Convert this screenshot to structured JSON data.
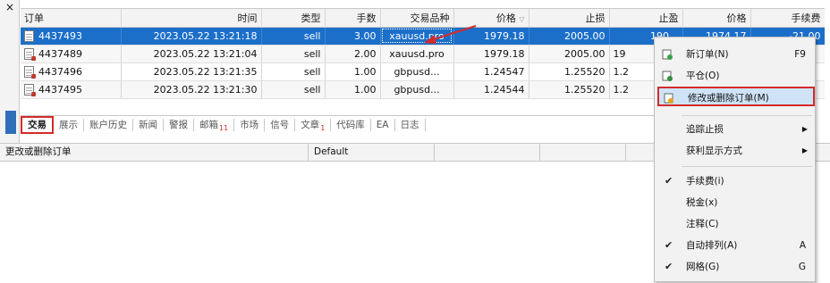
{
  "window": {
    "close_glyph": "×"
  },
  "table": {
    "headers": [
      "订单",
      "时间",
      "类型",
      "手数",
      "交易品种",
      "价格",
      "止损",
      "止盈",
      "价格",
      "手续费"
    ],
    "rows": [
      {
        "order": "4437493",
        "time": "2023.05.22 13:21:18",
        "type": "sell",
        "lots": "3.00",
        "symbol": "xauusd.pro",
        "price": "1979.18",
        "sl": "2005.00",
        "tp": "190...",
        "cur_price": "1974.17",
        "fee": "-21.00"
      },
      {
        "order": "4437489",
        "time": "2023.05.22 13:21:04",
        "type": "sell",
        "lots": "2.00",
        "symbol": "xauusd.pro",
        "price": "1979.18",
        "sl": "2005.00",
        "tp": "19",
        "cur_price": "",
        "fee": ""
      },
      {
        "order": "4437496",
        "time": "2023.05.22 13:21:35",
        "type": "sell",
        "lots": "1.00",
        "symbol": "gbpusd...",
        "price": "1.24547",
        "sl": "1.25520",
        "tp": "1.2",
        "cur_price": "",
        "fee": ""
      },
      {
        "order": "4437495",
        "time": "2023.05.22 13:21:30",
        "type": "sell",
        "lots": "1.00",
        "symbol": "gbpusd...",
        "price": "1.24544",
        "sl": "1.25520",
        "tp": "1.2",
        "cur_price": "",
        "fee": ""
      }
    ]
  },
  "tabs": [
    {
      "label": "交易",
      "badge": ""
    },
    {
      "label": "展示",
      "badge": ""
    },
    {
      "label": "账户历史",
      "badge": ""
    },
    {
      "label": "新闻",
      "badge": ""
    },
    {
      "label": "警报",
      "badge": ""
    },
    {
      "label": "邮箱",
      "badge": "11"
    },
    {
      "label": "市场",
      "badge": ""
    },
    {
      "label": "信号",
      "badge": ""
    },
    {
      "label": "文章",
      "badge": "1"
    },
    {
      "label": "代码库",
      "badge": ""
    },
    {
      "label": "EA",
      "badge": ""
    },
    {
      "label": "日志",
      "badge": ""
    }
  ],
  "status": {
    "left": "更改或删除订单",
    "middle": "Default"
  },
  "menu": {
    "new_order": {
      "label": "新订单(N)",
      "shortcut": "F9"
    },
    "close": {
      "label": "平仓(O)"
    },
    "modify": {
      "label": "修改或删除订单(M)"
    },
    "trailing": {
      "label": "追踪止损"
    },
    "profit_display": {
      "label": "获利显示方式"
    },
    "fee": {
      "label": "手续费(i)"
    },
    "tax": {
      "label": "税金(x)"
    },
    "comment": {
      "label": "注释(C)"
    },
    "autoarrange": {
      "label": "自动排列(A)",
      "shortcut": "A"
    },
    "gridmenu": {
      "label": "网格(G)",
      "shortcut": "G"
    }
  },
  "colors": {
    "selection": "#1c6fc9",
    "highlight_border": "#d32b2b",
    "menu_hover": "#cfe3f7"
  }
}
